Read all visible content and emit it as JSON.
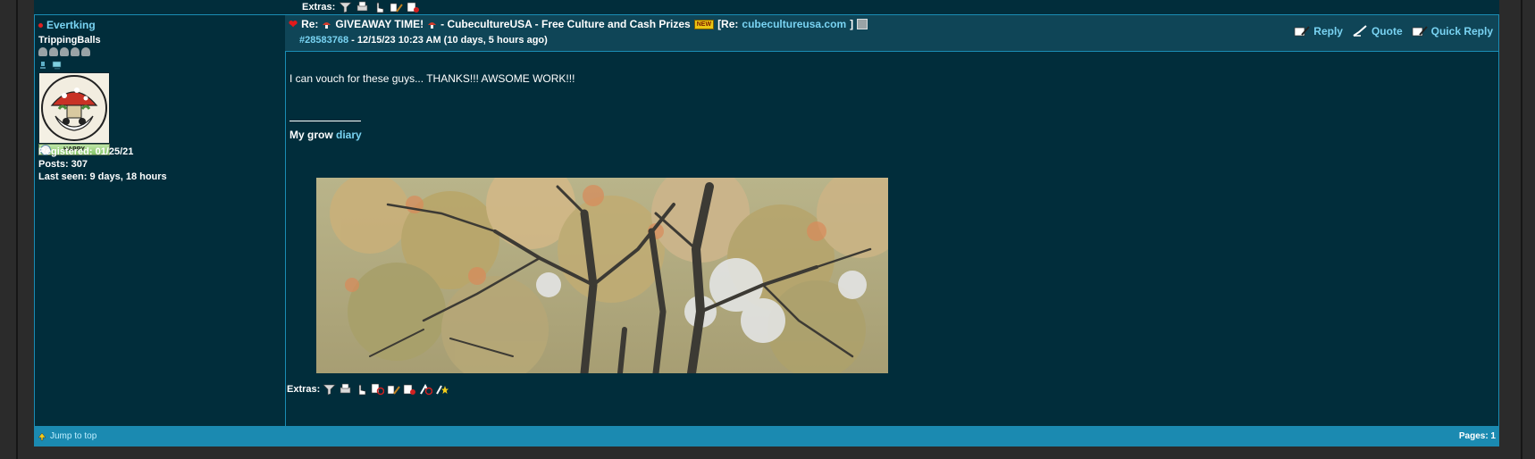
{
  "top_extras": {
    "label": "Extras:"
  },
  "author": {
    "username": "Evertking",
    "rank": "TrippingBalls",
    "mood": "HAPPY",
    "registered": "Registered: 01/25/21",
    "posts": "Posts: 307",
    "last_seen": "Last seen: 9 days, 18 hours"
  },
  "post": {
    "subject_prefix": "Re:",
    "subject_main": "GIVEAWAY TIME!",
    "subject_suffix": "- CubecultureUSA - Free Culture and Cash Prizes",
    "new_badge": "NEW",
    "re_prefix": "[Re:",
    "re_link": "cubecultureusa.com",
    "re_suffix": "]",
    "post_id": "#28583768",
    "timestamp": "- 12/15/23 10:23 AM (10 days, 5 hours ago)",
    "body": "I can vouch for these guys... THANKS!!! AWSOME WORK!!!",
    "signature_prefix": "My grow",
    "signature_link": "diary"
  },
  "actions": {
    "reply": "Reply",
    "quote": "Quote",
    "quick_reply": "Quick Reply"
  },
  "bottom_extras": {
    "label": "Extras:"
  },
  "footer": {
    "jump": "Jump to top",
    "pages": "Pages: 1"
  },
  "colors": {
    "background": "#012d3b",
    "header": "#0f4557",
    "link": "#79d3f2",
    "footer": "#1b8ab1",
    "border": "#1a8cb4"
  }
}
